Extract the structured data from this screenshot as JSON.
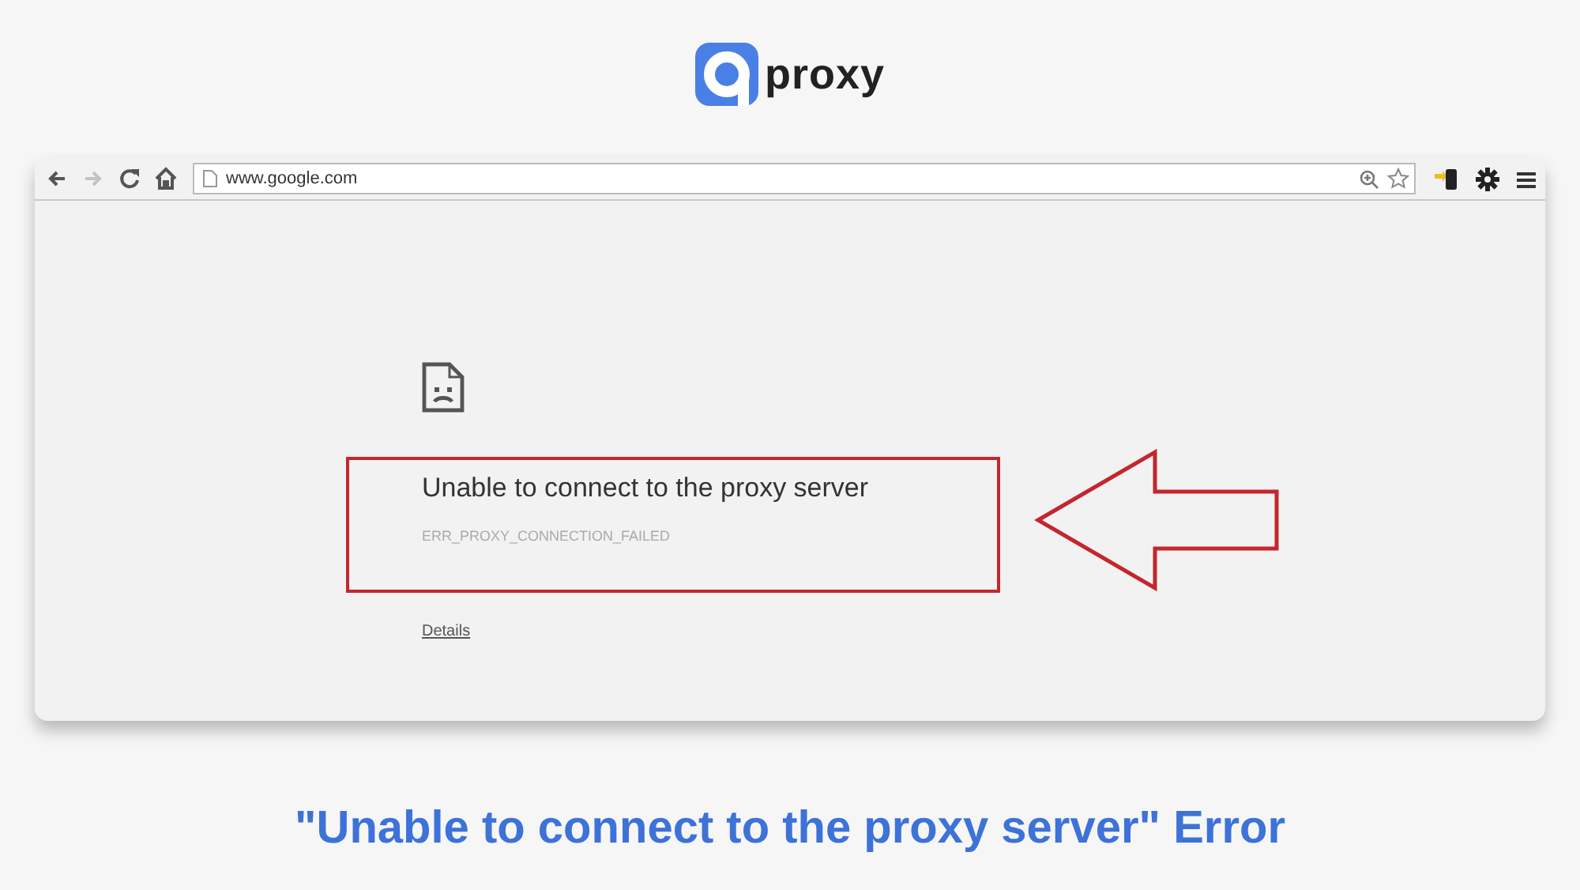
{
  "logo": {
    "text": "proxy"
  },
  "browser": {
    "toolbar": {
      "nav_buttons": [
        {
          "kind": "back",
          "disabled": false
        },
        {
          "kind": "forward",
          "disabled": true
        },
        {
          "kind": "reload",
          "disabled": false
        },
        {
          "kind": "home",
          "disabled": false
        }
      ],
      "address": "www.google.com"
    },
    "error_page": {
      "title": "Unable to connect to the proxy server",
      "code": "ERR_PROXY_CONNECTION_FAILED",
      "details_link": "Details"
    }
  },
  "caption": "\"Unable to connect to the proxy server\" Error"
}
